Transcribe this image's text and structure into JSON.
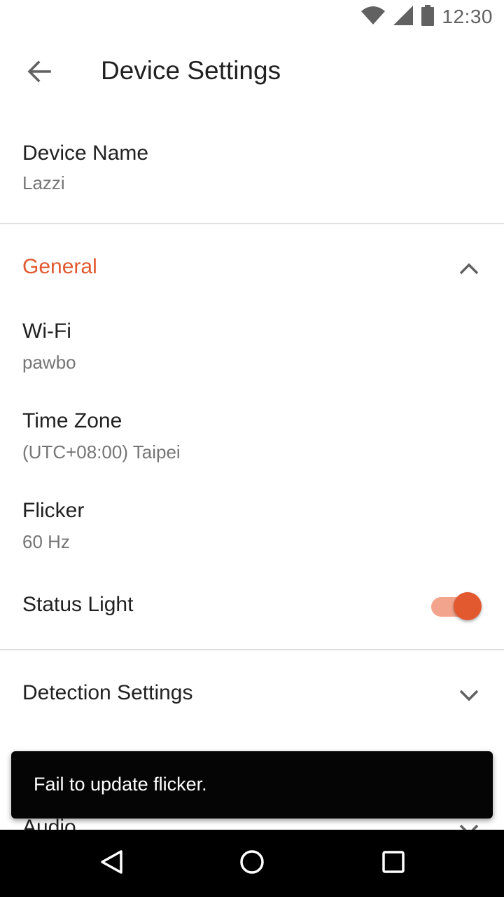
{
  "status_bar": {
    "time": "12:30",
    "icons": [
      "wifi-icon",
      "signal-icon",
      "battery-icon"
    ]
  },
  "toolbar": {
    "title": "Device Settings",
    "back_icon": "arrow-back-icon"
  },
  "device_name": {
    "label": "Device Name",
    "value": "Lazzi"
  },
  "general": {
    "header": "General",
    "expanded": true,
    "items": [
      {
        "label": "Wi-Fi",
        "value": "pawbo"
      },
      {
        "label": "Time Zone",
        "value": "(UTC+08:00) Taipei"
      },
      {
        "label": "Flicker",
        "value": "60 Hz"
      }
    ],
    "status_light": {
      "label": "Status Light",
      "on": true
    }
  },
  "detection": {
    "header": "Detection Settings",
    "expanded": false
  },
  "audio": {
    "header": "Audio",
    "expanded": false
  },
  "snackbar": {
    "message": "Fail to update flicker."
  },
  "nav_bar": {
    "icons": [
      "back-triangle-icon",
      "home-circle-icon",
      "recents-square-icon"
    ]
  },
  "colors": {
    "accent": "#E2582F",
    "accent_light": "#F2A48D",
    "text_primary": "#212121",
    "text_secondary": "#757575",
    "divider": "#E0E0E0"
  }
}
